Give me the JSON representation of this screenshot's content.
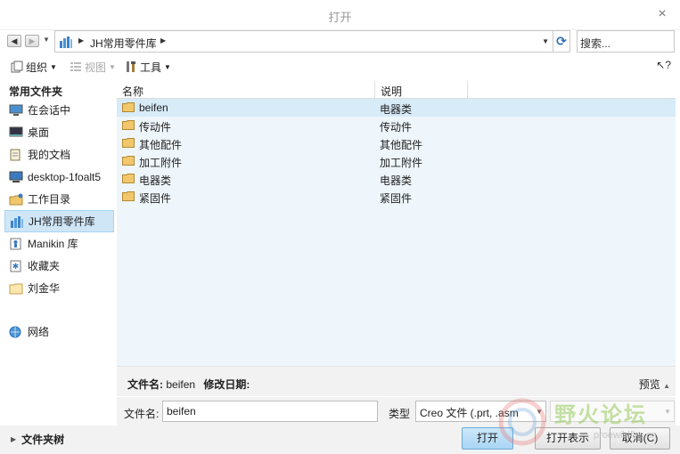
{
  "window": {
    "title": "打开",
    "close": "×"
  },
  "nav": {
    "back": "◀",
    "forward": "▶",
    "dropdown": "▼",
    "breadcrumb": "JH常用零件库",
    "search_placeholder": "搜索..."
  },
  "toolbar": {
    "organize": "组织",
    "view": "视图",
    "tools": "工具",
    "help": "?"
  },
  "sidebar": {
    "header": "常用文件夹",
    "items": [
      {
        "label": "在会话中",
        "icon": "session-icon"
      },
      {
        "label": "桌面",
        "icon": "desktop-icon"
      },
      {
        "label": "我的文档",
        "icon": "documents-icon"
      },
      {
        "label": "desktop-1foalt5",
        "icon": "computer-icon"
      },
      {
        "label": "工作目录",
        "icon": "working-directory-icon"
      },
      {
        "label": "JH常用零件库",
        "icon": "library-icon",
        "selected": true
      },
      {
        "label": "Manikin 库",
        "icon": "manikin-icon"
      },
      {
        "label": "收藏夹",
        "icon": "favorites-icon"
      },
      {
        "label": "刘金华",
        "icon": "folder-icon"
      }
    ],
    "network": "网络"
  },
  "filelist": {
    "col_name": "名称",
    "col_desc": "说明",
    "rows": [
      {
        "name": "beifen",
        "desc": "电器类",
        "selected": true
      },
      {
        "name": "传动件",
        "desc": "传动件"
      },
      {
        "name": "其他配件",
        "desc": "其他配件"
      },
      {
        "name": "加工附件",
        "desc": "加工附件"
      },
      {
        "name": "电器类",
        "desc": "电器类"
      },
      {
        "name": "紧固件",
        "desc": "紧固件"
      }
    ]
  },
  "info": {
    "filename_label": "文件名:",
    "filename_value": "beifen",
    "modified_label": "修改日期:",
    "preview": "预览"
  },
  "form": {
    "filename_label": "文件名:",
    "filename_value": "beifen",
    "type_label": "类型",
    "type_value": "Creo 文件 (.prt, .asm"
  },
  "bottom": {
    "folder_tree": "文件夹树",
    "open": "打开",
    "open_rep": "打开表示",
    "cancel": "取消(C)"
  },
  "watermark": {
    "text": "野火论坛",
    "sub": "proewildfire.cn"
  },
  "colors": {
    "accent": "#2a6db5",
    "selected": "#cfe6f7",
    "list_bg": "#eef6fc",
    "folder": "#f2c66a"
  }
}
